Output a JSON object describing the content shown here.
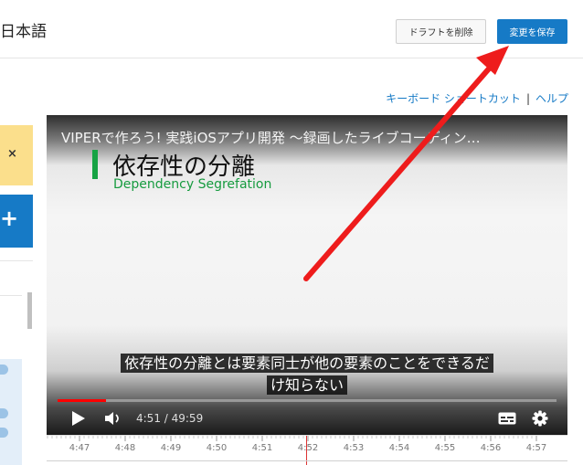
{
  "header": {
    "language": "日本語",
    "delete_draft_label": "ドラフトを削除",
    "save_label": "変更を保存"
  },
  "help_links": {
    "shortcuts": "キーボード ショートカット",
    "separator": "|",
    "help": "ヘルプ"
  },
  "side_cards": {
    "dismiss_symbol": "×",
    "add_symbol": "+"
  },
  "player": {
    "title": "VIPERで作ろう! 実践iOSアプリ開発 〜録画したライブコーディン…",
    "slide_heading": "依存性の分離",
    "slide_subheading": "Dependency Segrefation",
    "caption_line1": "依存性の分離とは要素同士が他の要素のことをできるだ",
    "caption_line2": "け知らない",
    "time_display": "4:51 / 49:59",
    "progress_fraction": 0.097
  },
  "timeline": {
    "ticks": [
      "4:47",
      "4:48",
      "4:49",
      "4:50",
      "4:51",
      "4:52",
      "4:53",
      "4:54",
      "4:55",
      "4:56",
      "4:57"
    ]
  },
  "colors": {
    "accent": "#167ac6",
    "annotation_arrow": "#ee1c1c",
    "progress": "#ff0000"
  }
}
